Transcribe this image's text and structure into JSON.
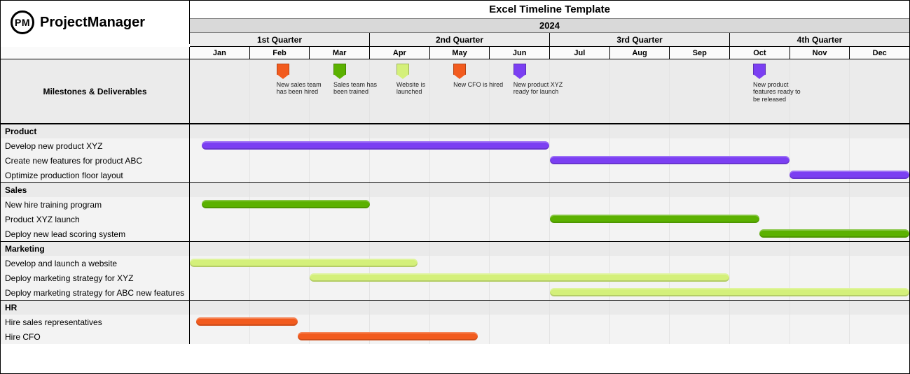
{
  "brand": {
    "logo_text": "PM",
    "name": "ProjectManager"
  },
  "title": "Excel Timeline Template",
  "year": "2024",
  "quarters": [
    "1st Quarter",
    "2nd Quarter",
    "3rd Quarter",
    "4th Quarter"
  ],
  "months": [
    "Jan",
    "Feb",
    "Mar",
    "Apr",
    "May",
    "Jun",
    "Jul",
    "Aug",
    "Sep",
    "Oct",
    "Nov",
    "Dec"
  ],
  "milestones_header": "Milestones & Deliverables",
  "milestones": [
    {
      "month_index": 1.55,
      "color": "c-orange",
      "label": "New sales team has been hired"
    },
    {
      "month_index": 2.5,
      "color": "c-green",
      "label": "Sales team has been trained"
    },
    {
      "month_index": 3.55,
      "color": "c-lime",
      "label": "Website is launched"
    },
    {
      "month_index": 4.5,
      "color": "c-orange",
      "label": "New CFO is hired"
    },
    {
      "month_index": 5.5,
      "color": "c-purple",
      "label": "New product XYZ ready for launch"
    },
    {
      "month_index": 9.5,
      "color": "c-purple",
      "label": "New  product features ready to be released"
    }
  ],
  "groups": [
    {
      "name": "Product",
      "color": "c-purple",
      "tasks": [
        {
          "name": "Develop new product XYZ",
          "start": 0.2,
          "end": 6.0
        },
        {
          "name": "Create new features for product ABC",
          "start": 6.0,
          "end": 10.0
        },
        {
          "name": "Optimize production floor layout",
          "start": 10.0,
          "end": 12.0
        }
      ]
    },
    {
      "name": "Sales",
      "color": "c-green",
      "tasks": [
        {
          "name": "New hire training program",
          "start": 0.2,
          "end": 3.0
        },
        {
          "name": "Product XYZ launch",
          "start": 6.0,
          "end": 9.5
        },
        {
          "name": "Deploy new lead scoring system",
          "start": 9.5,
          "end": 12.0
        }
      ]
    },
    {
      "name": "Marketing",
      "color": "c-lime",
      "tasks": [
        {
          "name": "Develop and launch a website",
          "start": 0.0,
          "end": 3.8
        },
        {
          "name": "Deploy marketing strategy for XYZ",
          "start": 2.0,
          "end": 9.0
        },
        {
          "name": "Deploy marketing strategy for ABC new features",
          "start": 6.0,
          "end": 12.0
        }
      ]
    },
    {
      "name": "HR",
      "color": "c-orange",
      "tasks": [
        {
          "name": "Hire sales representatives",
          "start": 0.1,
          "end": 1.8
        },
        {
          "name": "Hire CFO",
          "start": 1.8,
          "end": 4.8
        }
      ]
    }
  ],
  "chart_data": {
    "type": "bar",
    "orientation": "gantt",
    "title": "Excel Timeline Template",
    "x_unit": "month (2024)",
    "x_categories": [
      "Jan",
      "Feb",
      "Mar",
      "Apr",
      "May",
      "Jun",
      "Jul",
      "Aug",
      "Sep",
      "Oct",
      "Nov",
      "Dec"
    ],
    "xlim": [
      0,
      12
    ],
    "series": [
      {
        "group": "Product",
        "name": "Develop new product XYZ",
        "start": 0.2,
        "end": 6.0,
        "color": "purple"
      },
      {
        "group": "Product",
        "name": "Create new features for product ABC",
        "start": 6.0,
        "end": 10.0,
        "color": "purple"
      },
      {
        "group": "Product",
        "name": "Optimize production floor layout",
        "start": 10.0,
        "end": 12.0,
        "color": "purple"
      },
      {
        "group": "Sales",
        "name": "New hire training program",
        "start": 0.2,
        "end": 3.0,
        "color": "green"
      },
      {
        "group": "Sales",
        "name": "Product XYZ launch",
        "start": 6.0,
        "end": 9.5,
        "color": "green"
      },
      {
        "group": "Sales",
        "name": "Deploy new lead scoring system",
        "start": 9.5,
        "end": 12.0,
        "color": "green"
      },
      {
        "group": "Marketing",
        "name": "Develop and launch a website",
        "start": 0.0,
        "end": 3.8,
        "color": "lime"
      },
      {
        "group": "Marketing",
        "name": "Deploy marketing strategy for XYZ",
        "start": 2.0,
        "end": 9.0,
        "color": "lime"
      },
      {
        "group": "Marketing",
        "name": "Deploy marketing strategy for ABC new features",
        "start": 6.0,
        "end": 12.0,
        "color": "lime"
      },
      {
        "group": "HR",
        "name": "Hire sales representatives",
        "start": 0.1,
        "end": 1.8,
        "color": "orange"
      },
      {
        "group": "HR",
        "name": "Hire CFO",
        "start": 1.8,
        "end": 4.8,
        "color": "orange"
      }
    ],
    "milestones": [
      {
        "x": 1.55,
        "label": "New sales team has been hired",
        "color": "orange"
      },
      {
        "x": 2.5,
        "label": "Sales team has been trained",
        "color": "green"
      },
      {
        "x": 3.55,
        "label": "Website is launched",
        "color": "lime"
      },
      {
        "x": 4.5,
        "label": "New CFO is hired",
        "color": "orange"
      },
      {
        "x": 5.5,
        "label": "New product XYZ ready for launch",
        "color": "purple"
      },
      {
        "x": 9.5,
        "label": "New product features ready to be released",
        "color": "purple"
      }
    ]
  }
}
